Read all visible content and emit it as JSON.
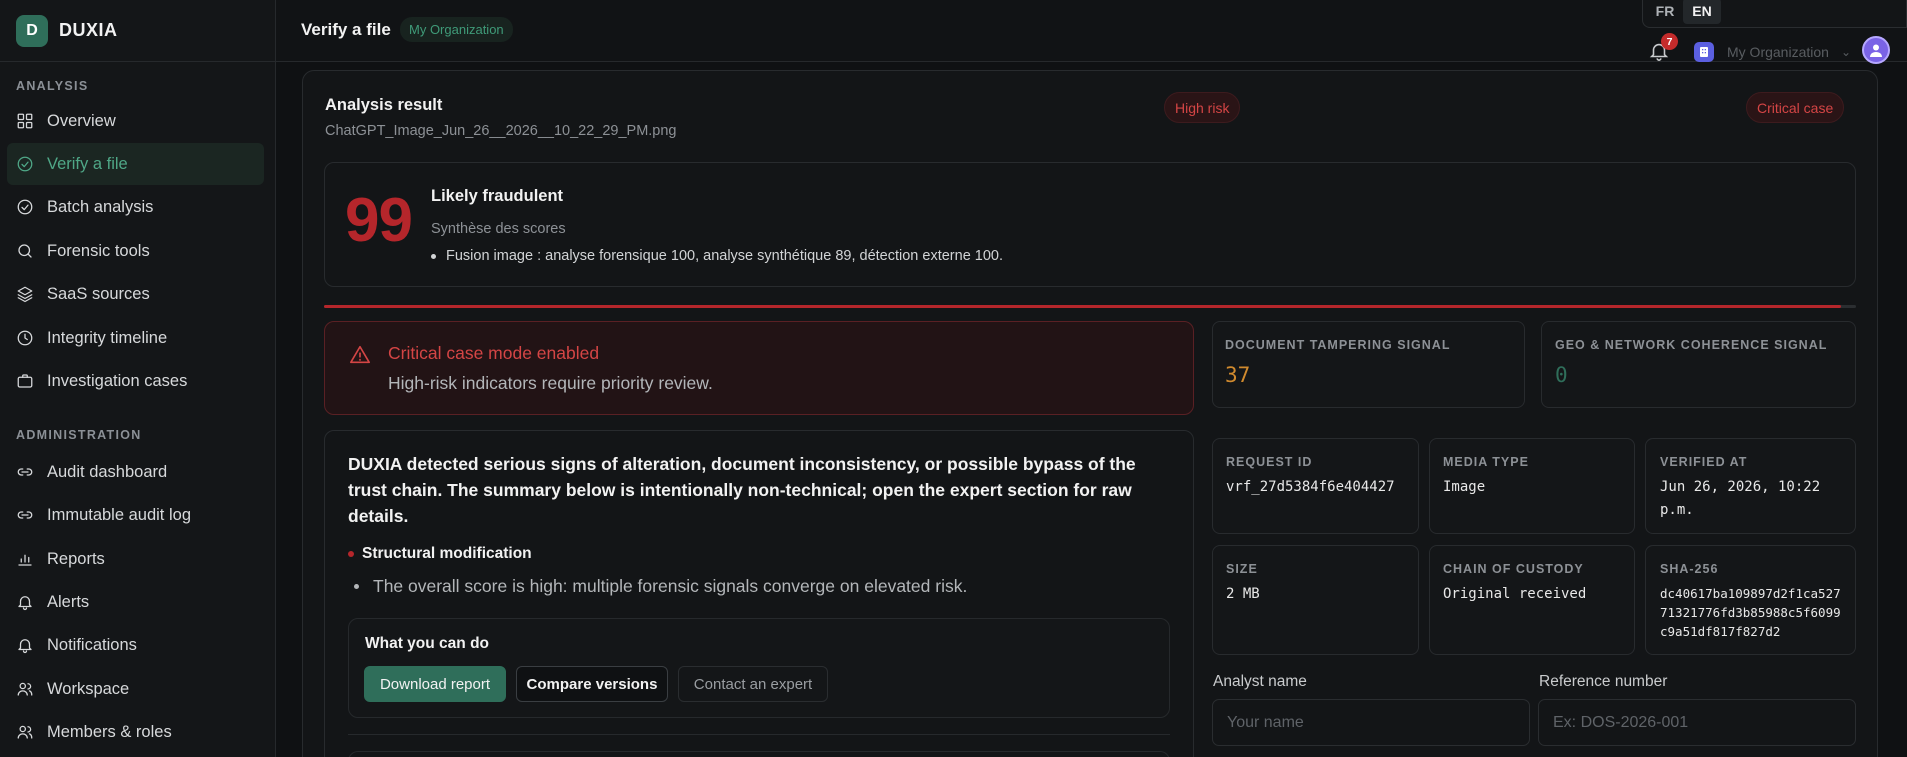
{
  "brand": {
    "logo_letter": "D",
    "name": "DUXIA",
    "accent": "#2f6e5a"
  },
  "sidebar": {
    "sections": [
      {
        "title": "ANALYSIS",
        "items": [
          {
            "label": "Overview",
            "icon": "grid-icon"
          },
          {
            "label": "Verify a file",
            "icon": "check-circle-icon",
            "active": true
          },
          {
            "label": "Batch analysis",
            "icon": "check-circle-icon"
          },
          {
            "label": "Forensic tools",
            "icon": "search-icon"
          },
          {
            "label": "SaaS sources",
            "icon": "layers-icon"
          },
          {
            "label": "Integrity timeline",
            "icon": "clock-icon"
          },
          {
            "label": "Investigation cases",
            "icon": "briefcase-icon"
          }
        ]
      },
      {
        "title": "ADMINISTRATION",
        "items": [
          {
            "label": "Audit dashboard",
            "icon": "link-icon"
          },
          {
            "label": "Immutable audit log",
            "icon": "link-icon"
          },
          {
            "label": "Reports",
            "icon": "bar-chart-icon"
          },
          {
            "label": "Alerts",
            "icon": "bell-icon"
          },
          {
            "label": "Notifications",
            "icon": "bell-icon"
          },
          {
            "label": "Workspace",
            "icon": "users-icon"
          },
          {
            "label": "Members & roles",
            "icon": "users-icon"
          }
        ]
      }
    ]
  },
  "header": {
    "title": "Verify a file",
    "org_badge": "My Organization",
    "languages": [
      "FR",
      "EN"
    ],
    "active_language": "EN",
    "notification_count": "7",
    "org_switcher_label": "My Organization"
  },
  "result": {
    "title": "Analysis result",
    "filename": "ChatGPT_Image_Jun_26__2026__10_22_29_PM.png",
    "risk_badge": "High risk",
    "case_badge": "Critical case",
    "score": "99",
    "verdict": "Likely fraudulent",
    "score_subtitle": "Synthèse des scores",
    "score_detail": "Fusion image : analyse forensique 100, analyse synthétique 89, détection externe 100.",
    "risk_progress": 0.99
  },
  "alert": {
    "title": "Critical case mode enabled",
    "text": "High-risk indicators require priority review."
  },
  "summary": {
    "text": "DUXIA detected serious signs of alteration, document inconsistency, or possible bypass of the trust chain. The summary below is intentionally non-technical; open the expert section for raw details.",
    "signal_title": "Structural modification",
    "signal_bullet": "The overall score is high: multiple forensic signals converge on elevated risk."
  },
  "actions": {
    "title": "What you can do",
    "download": "Download report",
    "compare": "Compare versions",
    "contact": "Contact an expert"
  },
  "signals": [
    {
      "label": "DOCUMENT TAMPERING SIGNAL",
      "value": "37",
      "color": "#d08a2e"
    },
    {
      "label": "GEO & NETWORK COHERENCE SIGNAL",
      "value": "0",
      "color": "#2f6e5a"
    }
  ],
  "meta": {
    "request_id_label": "REQUEST ID",
    "request_id": "vrf_27d5384f6e404427",
    "media_type_label": "MEDIA TYPE",
    "media_type": "Image",
    "verified_at_label": "VERIFIED AT",
    "verified_at_line1": "Jun 26, 2026, 10:22",
    "verified_at_line2": "p.m.",
    "size_label": "SIZE",
    "size": "2 MB",
    "custody_label": "CHAIN OF CUSTODY",
    "custody": "Original received",
    "sha_label": "SHA-256",
    "sha_line1": "dc40617ba109897d2f1ca527",
    "sha_line2": "71321776fd3b85988c5f6099",
    "sha_line3": "c9a51df817f827d2"
  },
  "form": {
    "analyst_label": "Analyst name",
    "analyst_placeholder": "Your name",
    "analyst_value": "",
    "reference_label": "Reference number",
    "reference_placeholder": "Ex: DOS-2026-001",
    "reference_value": ""
  }
}
